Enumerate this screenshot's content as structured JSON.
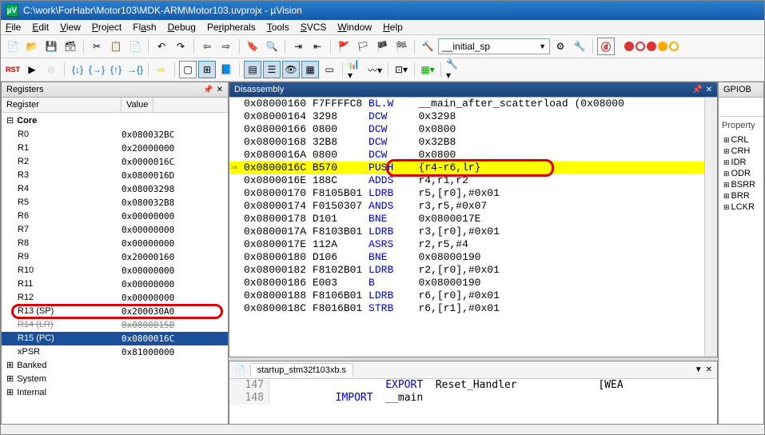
{
  "window": {
    "title": "C:\\work\\ForHabr\\Motor103\\MDK-ARM\\Motor103.uvprojx - µVision"
  },
  "menu": [
    "File",
    "Edit",
    "View",
    "Project",
    "Flash",
    "Debug",
    "Peripherals",
    "Tools",
    "SVCS",
    "Window",
    "Help"
  ],
  "toolbar": {
    "combo1": "__initial_sp"
  },
  "panels": {
    "registers": "Registers",
    "disasm": "Disassembly",
    "gpiob": "GPIOB",
    "regcol1": "Register",
    "regcol2": "Value",
    "property": "Property"
  },
  "registers": {
    "core": "Core",
    "rows": [
      {
        "n": "R0",
        "v": "0x080032BC"
      },
      {
        "n": "R1",
        "v": "0x20000000"
      },
      {
        "n": "R2",
        "v": "0x0000016C"
      },
      {
        "n": "R3",
        "v": "0x0800016D"
      },
      {
        "n": "R4",
        "v": "0x08003298"
      },
      {
        "n": "R5",
        "v": "0x080032B8"
      },
      {
        "n": "R6",
        "v": "0x00000000"
      },
      {
        "n": "R7",
        "v": "0x00000000"
      },
      {
        "n": "R8",
        "v": "0x00000000"
      },
      {
        "n": "R9",
        "v": "0x20000160"
      },
      {
        "n": "R10",
        "v": "0x00000000"
      },
      {
        "n": "R11",
        "v": "0x00000000"
      },
      {
        "n": "R12",
        "v": "0x00000000"
      },
      {
        "n": "R13 (SP)",
        "v": "0x200030A0"
      },
      {
        "n": "R14 (LR)",
        "v": "0x0800015B"
      },
      {
        "n": "R15 (PC)",
        "v": "0x0800016C"
      },
      {
        "n": "xPSR",
        "v": "0x81000000"
      }
    ],
    "groups": [
      "Banked",
      "System",
      "Internal"
    ]
  },
  "disasm": [
    {
      "a": "0x08000160",
      "h": "F7FFFFC8",
      "m": "BL.W",
      "o": "__main_after_scatterload (0x08000"
    },
    {
      "a": "0x08000164",
      "h": "3298",
      "m": "DCW",
      "o": "0x3298"
    },
    {
      "a": "0x08000166",
      "h": "0800",
      "m": "DCW",
      "o": "0x0800"
    },
    {
      "a": "0x08000168",
      "h": "32B8",
      "m": "DCW",
      "o": "0x32B8"
    },
    {
      "a": "0x0800016A",
      "h": "0800",
      "m": "DCW",
      "o": "0x0800"
    },
    {
      "a": "0x0800016C",
      "h": "B570",
      "m": "PUSH",
      "o": "{r4-r6,lr}",
      "cur": true
    },
    {
      "a": "0x0800016E",
      "h": "188C",
      "m": "ADDS",
      "o": "r4,r1,r2"
    },
    {
      "a": "0x08000170",
      "h": "F8105B01",
      "m": "LDRB",
      "o": "r5,[r0],#0x01"
    },
    {
      "a": "0x08000174",
      "h": "F0150307",
      "m": "ANDS",
      "o": "r3,r5,#0x07"
    },
    {
      "a": "0x08000178",
      "h": "D101",
      "m": "BNE",
      "o": "0x0800017E"
    },
    {
      "a": "0x0800017A",
      "h": "F8103B01",
      "m": "LDRB",
      "o": "r3,[r0],#0x01"
    },
    {
      "a": "0x0800017E",
      "h": "112A",
      "m": "ASRS",
      "o": "r2,r5,#4"
    },
    {
      "a": "0x08000180",
      "h": "D106",
      "m": "BNE",
      "o": "0x08000190"
    },
    {
      "a": "0x08000182",
      "h": "F8102B01",
      "m": "LDRB",
      "o": "r2,[r0],#0x01"
    },
    {
      "a": "0x08000186",
      "h": "E003",
      "m": "B",
      "o": "0x08000190"
    },
    {
      "a": "0x08000188",
      "h": "F8106B01",
      "m": "LDRB",
      "o": "r6,[r0],#0x01"
    },
    {
      "a": "0x0800018C",
      "h": "F8016B01",
      "m": "STRB",
      "o": "r6,[r1],#0x01"
    }
  ],
  "src": {
    "file": "startup_stm32f103xb.s",
    "lines": [
      {
        "n": "147",
        "t": "                EXPORT  Reset_Handler             [WEA"
      },
      {
        "n": "148",
        "t": "        IMPORT  __main"
      }
    ]
  },
  "gpiob": [
    "CRL",
    "CRH",
    "IDR",
    "ODR",
    "BSRR",
    "BRR",
    "LCKR"
  ]
}
